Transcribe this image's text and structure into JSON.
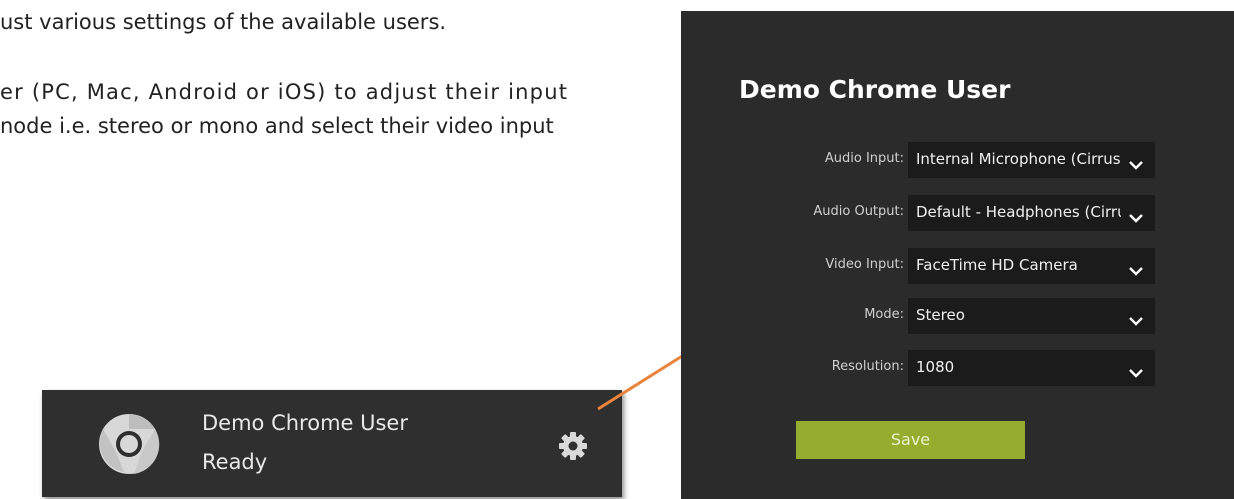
{
  "document": {
    "line1": "ust various settings of the available users.",
    "line2": "er (PC, Mac, Android or iOS) to adjust their input",
    "line3": "node i.e. stereo or mono and select their video input"
  },
  "user_card": {
    "name": "Demo Chrome User",
    "status": "Ready",
    "icon": "chrome-icon",
    "settings_icon": "gear-icon"
  },
  "settings": {
    "title": "Demo Chrome User",
    "fields": [
      {
        "label": "Audio Input:",
        "value": "Internal Microphone (Cirrus"
      },
      {
        "label": "Audio Output:",
        "value": "Default - Headphones (Cirrus"
      },
      {
        "label": "Video Input:",
        "value": "FaceTime HD Camera"
      },
      {
        "label": "Mode:",
        "value": "Stereo"
      },
      {
        "label": "Resolution:",
        "value": "1080"
      }
    ],
    "save_label": "Save"
  },
  "colors": {
    "panel_bg": "#2b2b2b",
    "select_bg": "#1b1b1b",
    "save_green": "#94ad2f",
    "arrow_orange": "#e8843c"
  }
}
